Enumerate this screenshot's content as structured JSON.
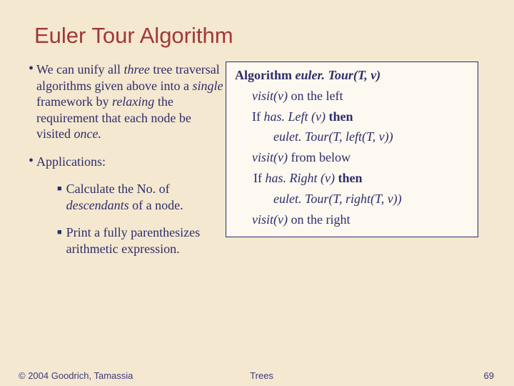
{
  "title": "Euler Tour Algorithm",
  "bullet1": {
    "p1": "We can unify all ",
    "three": "three",
    "p2": " tree traversal algorithms given above into a ",
    "single": "single",
    "p3": " framework by ",
    "relaxing": "relaxing",
    "p4": " the requirement that each node be visited ",
    "once": "once.",
    "p5": ""
  },
  "bullet2": "Applications:",
  "sub1": {
    "p1": "Calculate the No. of ",
    "descendants": "descendants",
    "p2": " of a node."
  },
  "sub2": "Print a fully parenthesizes arithmetic expression.",
  "algo": {
    "l1a": "Algorithm",
    "l1b": " euler. Tour(T, v)",
    "l2a": "visit(v)",
    "l2b": " on the left",
    "l3a": "If ",
    "l3b": "has. Left (v) ",
    "l3c": "then",
    "l4": "eulet. Tour(T, left(T, v))",
    "l5a": "visit(v)",
    "l5b": " from below",
    "l6a": " If ",
    "l6b": "has. Right (v)",
    "l6c": " then",
    "l7": "eulet. Tour(T, right(T, v))",
    "l8a": "visit(v)",
    "l8b": " on the right"
  },
  "footer": {
    "copyright": "© 2004 Goodrich, Tamassia",
    "center": "Trees",
    "page": "69"
  }
}
